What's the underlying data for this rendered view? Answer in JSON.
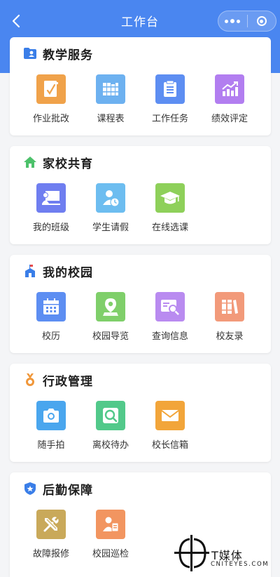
{
  "header": {
    "title": "工作台",
    "back_icon": "chevron-left-icon",
    "more_icon": "more-dots-icon",
    "close_icon": "target-circle-icon"
  },
  "colors": {
    "primary": "#4a86f0",
    "background": "#f4f5f7"
  },
  "sections": [
    {
      "title": "教学服务",
      "icon": "folder-user-icon",
      "icon_color": "#3a7ee8",
      "items": [
        {
          "label": "作业批改",
          "icon": "homework-check-icon",
          "color": "#f0a24a"
        },
        {
          "label": "课程表",
          "icon": "course-books-icon",
          "color": "#6db1f0"
        },
        {
          "label": "工作任务",
          "icon": "task-list-icon",
          "color": "#5d8ef2"
        },
        {
          "label": "绩效评定",
          "icon": "performance-chart-icon",
          "color": "#b27ef0"
        }
      ]
    },
    {
      "title": "家校共育",
      "icon": "home-icon",
      "icon_color": "#4cc16a",
      "items": [
        {
          "label": "我的班级",
          "icon": "class-board-icon",
          "color": "#6f7ef0"
        },
        {
          "label": "学生请假",
          "icon": "student-leave-icon",
          "color": "#6dbdf0"
        },
        {
          "label": "在线选课",
          "icon": "graduation-cap-icon",
          "color": "#8ed05a"
        }
      ]
    },
    {
      "title": "我的校园",
      "icon": "campus-building-icon",
      "icon_color": "#3a7ee8",
      "items": [
        {
          "label": "校历",
          "icon": "calendar-icon",
          "color": "#5d8ef2"
        },
        {
          "label": "校园导览",
          "icon": "map-pin-icon",
          "color": "#7fcf6a"
        },
        {
          "label": "查询信息",
          "icon": "search-card-icon",
          "color": "#b98bf0"
        },
        {
          "label": "校友录",
          "icon": "books-shelf-icon",
          "color": "#f29a7a"
        }
      ]
    },
    {
      "title": "行政管理",
      "icon": "medal-icon",
      "icon_color": "#f0973a",
      "items": [
        {
          "label": "随手拍",
          "icon": "camera-icon",
          "color": "#4aa6ee"
        },
        {
          "label": "离校待办",
          "icon": "magnifier-icon",
          "color": "#52c98a"
        },
        {
          "label": "校长信箱",
          "icon": "mail-icon",
          "color": "#f2a53a"
        }
      ]
    },
    {
      "title": "后勤保障",
      "icon": "shield-star-icon",
      "icon_color": "#3a7ee8",
      "items": [
        {
          "label": "故障报修",
          "icon": "tools-icon",
          "color": "#c9a95a"
        },
        {
          "label": "校园巡检",
          "icon": "inspector-icon",
          "color": "#f29560"
        }
      ]
    }
  ],
  "watermark": {
    "name": "T媒体",
    "domain": "CNITEYES.COM",
    "logo_icon": "tmedia-logo-icon"
  }
}
